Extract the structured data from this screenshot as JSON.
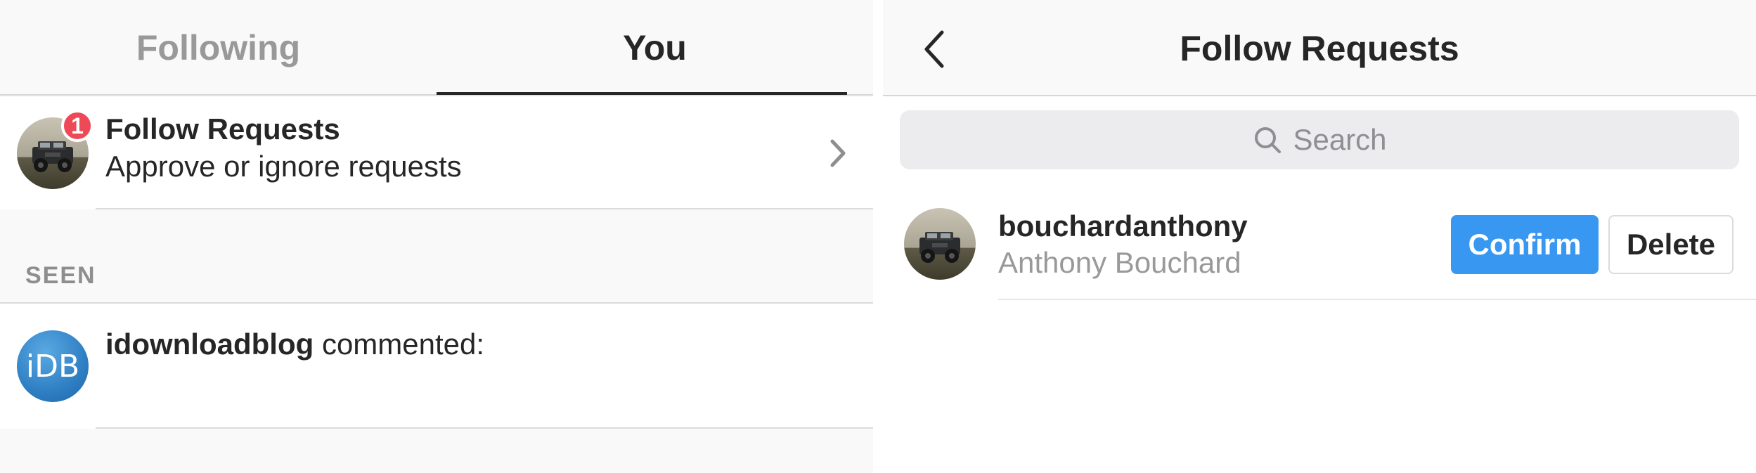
{
  "activity": {
    "tabs": [
      {
        "label": "Following",
        "active": false
      },
      {
        "label": "You",
        "active": true
      }
    ],
    "follow_requests": {
      "title": "Follow Requests",
      "subtitle": "Approve or ignore requests",
      "badge_count": "1",
      "avatar_icon": "jeep-photo-avatar",
      "chevron_icon": "chevron-right-icon"
    },
    "section_label": "SEEN",
    "seen_item": {
      "username": "idownloadblog",
      "action": " commented:",
      "avatar_text": "iDB"
    }
  },
  "follow_requests_page": {
    "back_icon": "chevron-left-icon",
    "title": "Follow Requests",
    "search": {
      "placeholder": "Search",
      "icon": "search-icon"
    },
    "requests": [
      {
        "username": "bouchardanthony",
        "full_name": "Anthony Bouchard",
        "confirm_label": "Confirm",
        "delete_label": "Delete"
      }
    ]
  },
  "colors": {
    "accent_blue": "#3897f0",
    "badge_red": "#ed4956",
    "text_primary": "#262626",
    "text_secondary": "#999999",
    "background": "#f9f9f9"
  }
}
